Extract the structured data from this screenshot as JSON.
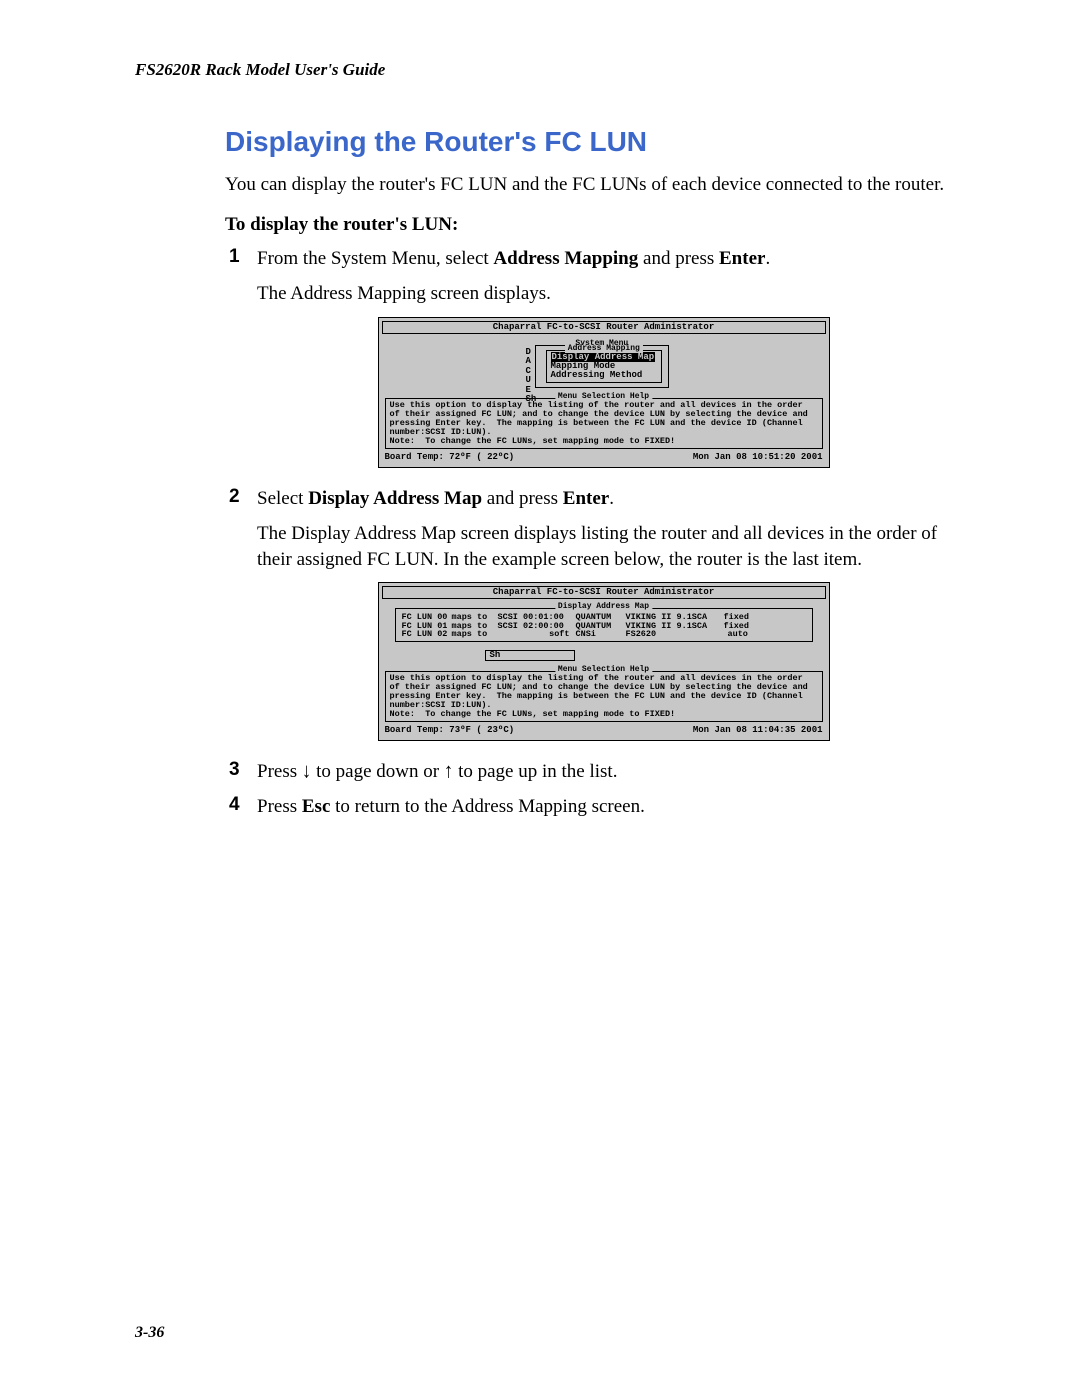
{
  "running_head": "FS2620R Rack Model User's Guide",
  "section_title": "Displaying the Router's FC LUN",
  "intro": "You can display the router's FC LUN and the FC LUNs of each device connected to the router.",
  "procedure_label": "To display the router's LUN:",
  "steps": {
    "s1a": "From the System Menu, select ",
    "s1b": "Address Mapping",
    "s1c": " and press ",
    "s1d": "Enter",
    "s1e": ".",
    "s1f": "The Address Mapping screen displays.",
    "s2a": "Select ",
    "s2b": "Display Address Map",
    "s2c": " and press ",
    "s2d": "Enter",
    "s2e": ".",
    "s2f": "The Display Address Map screen displays listing the router and all devices in the order of their assigned FC LUN. In the example screen below, the router is the last item.",
    "s3a": "Press ",
    "s3b": "↓",
    "s3c": " to page down or ",
    "s3d": "↑",
    "s3e": " to page up in the list.",
    "s4a": "Press ",
    "s4b": "Esc",
    "s4c": " to return to the Address Mapping screen."
  },
  "screenshot1": {
    "title": "Chaparral FC-to-SCSI Router Administrator",
    "system_menu_label": "System Menu",
    "address_mapping_label": "Address Mapping",
    "menu_items": {
      "i1": "Display Address Map",
      "i2": "Mapping Mode",
      "i3": "Addressing Method"
    },
    "side_letters": "D\nA\nC\nU\nE\nSh",
    "help_label": "Menu Selection Help",
    "help_text": "Use this option to display the listing of the router and all devices in the order of their assigned FC LUN; and to change the device LUN by selecting the device and pressing Enter key.  The mapping is between the FC LUN and the device ID (Channel number:SCSI ID:LUN).\nNote:  To change the FC LUNs, set mapping mode to FIXED!",
    "status_left": "Board Temp:  72ºF ( 22ºC)",
    "status_right": "Mon Jan 08 10:51:20 2001"
  },
  "screenshot2": {
    "title": "Chaparral FC-to-SCSI Router Administrator",
    "map_label": "Display Address Map",
    "rows": [
      {
        "lun": "FC LUN 00",
        "maps": "maps to",
        "scsi": "SCSI 00:01:00",
        "vendor": "QUANTUM",
        "model": "VIKING II 9.1SCA",
        "mode": "fixed"
      },
      {
        "lun": "FC LUN 01",
        "maps": "maps to",
        "scsi": "SCSI 02:00:00",
        "vendor": "QUANTUM",
        "model": "VIKING II 9.1SCA",
        "mode": "fixed"
      },
      {
        "lun": "FC LUN 02",
        "maps": "maps to",
        "scsi": "soft",
        "vendor": "CNSi",
        "model": "FS2620",
        "mode": "auto"
      }
    ],
    "sh_label": "Sh",
    "help_label": "Menu Selection Help",
    "help_text": "Use this option to display the listing of the router and all devices in the order of their assigned FC LUN; and to change the device LUN by selecting the device and pressing Enter key.  The mapping is between the FC LUN and the device ID (Channel number:SCSI ID:LUN).\nNote:  To change the FC LUNs, set mapping mode to FIXED!",
    "status_left": "Board Temp:  73ºF ( 23ºC)",
    "status_right": "Mon Jan 08 11:04:35 2001"
  },
  "page_number": "3-36"
}
